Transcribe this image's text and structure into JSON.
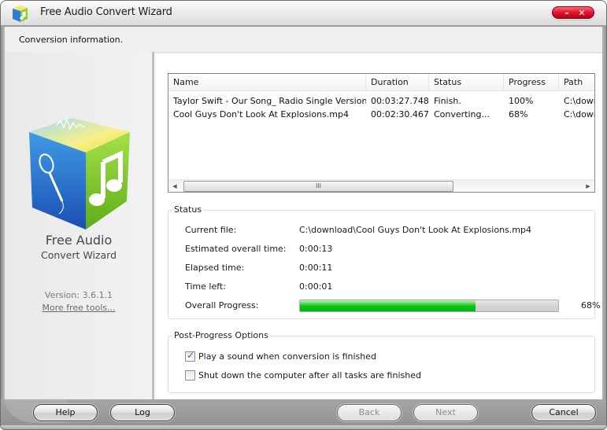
{
  "window": {
    "title": "Free Audio Convert Wizard",
    "icon": "app-cube-icon",
    "controls": {
      "minimize": "–",
      "close": "✕"
    }
  },
  "header": {
    "text": "Conversion information."
  },
  "sidebar": {
    "logo": "app-cube-logo-icon",
    "brand_line1": "Free Audio",
    "brand_line2": "Convert Wizard",
    "version": "Version: 3.6.1.1",
    "more_tools": "More free tools..."
  },
  "file_list": {
    "columns": [
      "Name",
      "Duration",
      "Status",
      "Progress",
      "Path"
    ],
    "rows": [
      {
        "name": "Taylor Swift - Our Song_ Radio Single Version - ...",
        "duration": "00:03:27.748",
        "status": "Finish.",
        "progress": "100%",
        "path": "C:\\down"
      },
      {
        "name": "Cool Guys Don't Look At Explosions.mp4",
        "duration": "00:02:30.467",
        "status": "Converting...",
        "progress": "68%",
        "path": "C:\\down"
      }
    ],
    "scrollbar": {
      "left_arrow": "◀",
      "right_arrow": "▶",
      "grip": "III"
    }
  },
  "status": {
    "title": "Status",
    "current_file_label": "Current file:",
    "current_file_value": "C:\\download\\Cool Guys Don't Look At Explosions.mp4",
    "estimated_label": "Estimated overall time:",
    "estimated_value": "0:00:13",
    "elapsed_label": "Elapsed time:",
    "elapsed_value": "0:00:11",
    "time_left_label": "Time left:",
    "time_left_value": "0:00:01",
    "overall_progress_label": "Overall Progress:",
    "overall_progress_percent": 68,
    "overall_progress_text": "68%"
  },
  "post_options": {
    "title": "Post-Progress Options",
    "options": [
      {
        "label": "Play a sound when conversion is finished",
        "checked": true
      },
      {
        "label": "Shut down the computer after all tasks are finished",
        "checked": false
      }
    ]
  },
  "footer": {
    "help": "Help",
    "log": "Log",
    "back": "Back",
    "next": "Next",
    "cancel": "Cancel",
    "back_disabled": true,
    "next_disabled": true
  }
}
